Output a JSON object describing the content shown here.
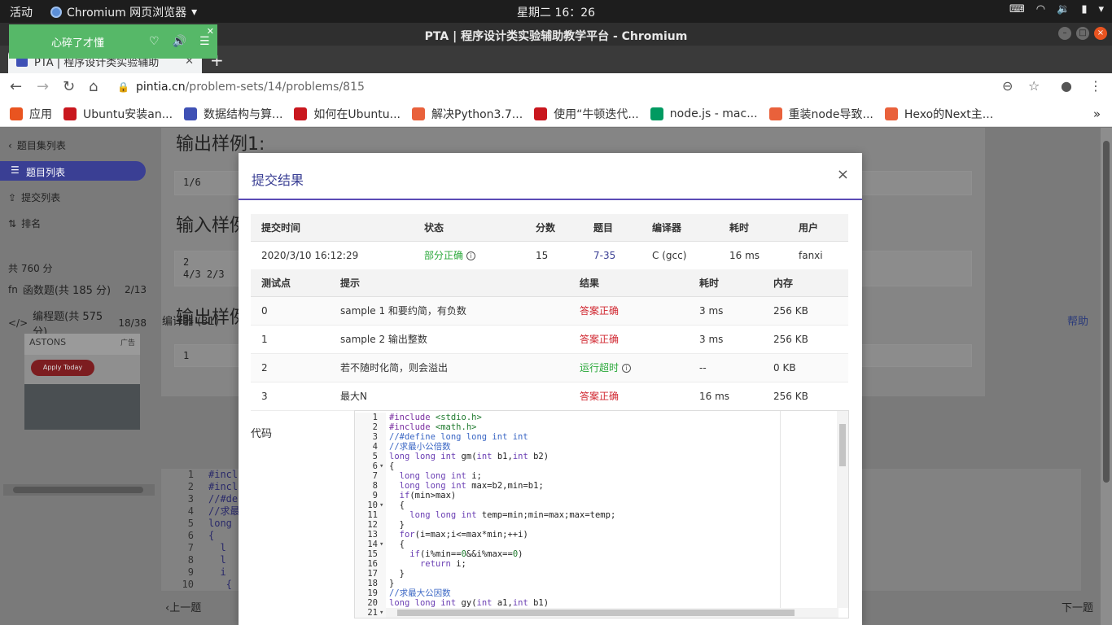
{
  "system": {
    "activities": "活动",
    "app_name": "Chromium 网页浏览器",
    "clock": "星期二 16：26"
  },
  "window": {
    "title": "PTA | 程序设计类实验辅助教学平台 - Chromium"
  },
  "music": {
    "song": "心碎了才懂"
  },
  "tab": {
    "title": "PTA | 程序设计类实验辅助"
  },
  "address": {
    "domain": "pintia.cn",
    "path": "/problem-sets/14/problems/815"
  },
  "bookmarks": [
    {
      "label": "应用",
      "icon": "apps-grid-icon",
      "color": "#e95420"
    },
    {
      "label": "Ubuntu安装an...",
      "icon": "csdn-icon",
      "color": "#c9171e"
    },
    {
      "label": "数据结构与算...",
      "icon": "puzzle-icon",
      "color": "#3f51b5"
    },
    {
      "label": "如何在Ubuntu...",
      "icon": "csdn-icon",
      "color": "#c9171e"
    },
    {
      "label": "解决Python3.7...",
      "icon": "jianshu-icon",
      "color": "#e9613b"
    },
    {
      "label": "使用“牛顿迭代...",
      "icon": "csdn-icon",
      "color": "#c9171e"
    },
    {
      "label": "node.js - mac...",
      "icon": "segmentfault-icon",
      "color": "#009a61"
    },
    {
      "label": "重装node导致...",
      "icon": "jianshu-icon",
      "color": "#e9613b"
    },
    {
      "label": "Hexo的Next主...",
      "icon": "jianshu-icon",
      "color": "#e9613b"
    }
  ],
  "sidebar": {
    "back": "题目集列表",
    "problems": "题目列表",
    "submissions": "提交列表",
    "ranking": "排名",
    "total": "共 760 分",
    "func_label": "函数题(共 185 分)",
    "func_progress": "2/13",
    "prog_label": "编程题(共 575 分)",
    "prog_progress": "18/38",
    "ad_brand": "ASTONS",
    "ad_tag": "广告",
    "ad_button": "Apply Today"
  },
  "content": {
    "h_out1": "输出样例1:",
    "sample1": "1/6",
    "h_in2": "输入样例",
    "sample2": "2\n4/3 2/3",
    "h_out2": "输出样例",
    "sample3": "1",
    "compiler": "编译器 (31)",
    "help": "帮助",
    "prev": "上一题",
    "next": "下一题",
    "editor_lines": [
      "1",
      "2",
      "3",
      "4",
      "5",
      "6",
      "7",
      "8",
      "9",
      "10"
    ],
    "editor_code": [
      "#incl",
      "#incl",
      "//#de",
      "//求最",
      "long ",
      "{",
      "  l",
      "  l",
      "  i",
      "   {"
    ]
  },
  "modal": {
    "title": "提交结果",
    "close": "×",
    "summary_headers": [
      "提交时间",
      "状态",
      "分数",
      "题目",
      "编译器",
      "耗时",
      "用户"
    ],
    "summary": {
      "time": "2020/3/10 16:12:29",
      "status": "部分正确",
      "score": "15",
      "problem": "7-35",
      "compiler": "C (gcc)",
      "duration": "16 ms",
      "user": "fanxi"
    },
    "case_headers": [
      "测试点",
      "提示",
      "结果",
      "耗时",
      "内存"
    ],
    "cases": [
      {
        "id": "0",
        "hint": "sample 1 和要约简，有负数",
        "result": "答案正确",
        "time": "3 ms",
        "mem": "256 KB"
      },
      {
        "id": "1",
        "hint": "sample 2 输出整数",
        "result": "答案正确",
        "time": "3 ms",
        "mem": "256 KB"
      },
      {
        "id": "2",
        "hint": "若不随时化简，则会溢出",
        "result": "运行超时",
        "time": "--",
        "mem": "0 KB"
      },
      {
        "id": "3",
        "hint": "最大N",
        "result": "答案正确",
        "time": "16 ms",
        "mem": "256 KB"
      }
    ],
    "code_label": "代码",
    "code_lines": [
      "#include <stdio.h>",
      "#include <math.h>",
      "//#define long long int int",
      "//求最小公倍数",
      "long long int gm(int b1,int b2)",
      "{",
      "  long long int i;",
      "  long long int max=b2,min=b1;",
      "  if(min>max)",
      "  {",
      "    long long int temp=min;min=max;max=temp;",
      "  }",
      "  for(i=max;i<=max*min;++i)",
      "  {",
      "    if(i%min==0&&i%max==0)",
      "      return i;",
      "  }",
      "}",
      "//求最大公因数",
      "long long int gy(int a1,int b1)",
      ""
    ],
    "fold_lines": [
      6,
      10,
      14,
      21
    ]
  }
}
